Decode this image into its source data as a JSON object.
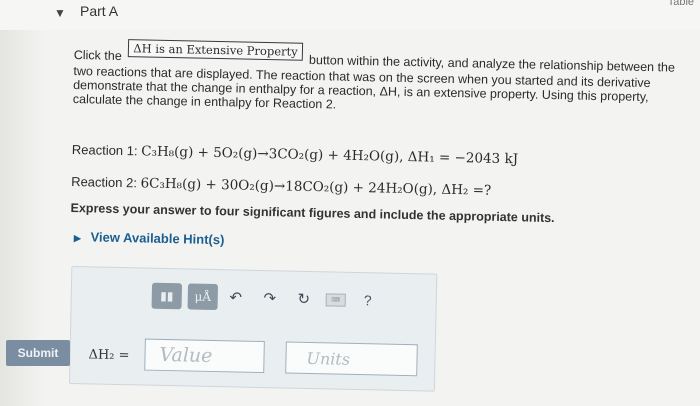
{
  "header": {
    "part_toggle_icon": "▼",
    "part_title": "Part A",
    "corner_link": "Table"
  },
  "instructions": {
    "prefix": "Click the",
    "button_label": "ΔH is an Extensive Property",
    "body": "button within the activity, and analyze the relationship between the two reactions that are displayed. The reaction that was on the screen when you started and its derivative demonstrate that the change in enthalpy for a reaction, ΔH, is an extensive property. Using this property, calculate the change in enthalpy for Reaction 2."
  },
  "reactions": [
    {
      "label": "Reaction 1:",
      "equation": "C₃H₈(g) + 5O₂(g)→3CO₂(g) + 4H₂O(g), ΔH₁ = −2043 kJ"
    },
    {
      "label": "Reaction 2:",
      "equation": "6C₃H₈(g) + 30O₂(g)→18CO₂(g) + 24H₂O(g), ΔH₂ =?"
    }
  ],
  "express_text": "Express your answer to four significant figures and include the appropriate units.",
  "hint": {
    "icon": "▶",
    "label": "View Available Hint(s)"
  },
  "toolbar": {
    "template_icon": "▮▮",
    "mu_label": "μÅ",
    "undo_icon": "↶",
    "redo_icon": "↷",
    "reset_icon": "↻",
    "keyboard_icon": "⌨",
    "help_label": "?"
  },
  "answer": {
    "label": "ΔH₂ =",
    "value_placeholder": "Value",
    "units_placeholder": "Units"
  },
  "submit_label": "Submit",
  "colors": {
    "hint_link": "#1b5f90",
    "tool_button": "#8d9ba6",
    "submit": "#7b8ea1"
  }
}
